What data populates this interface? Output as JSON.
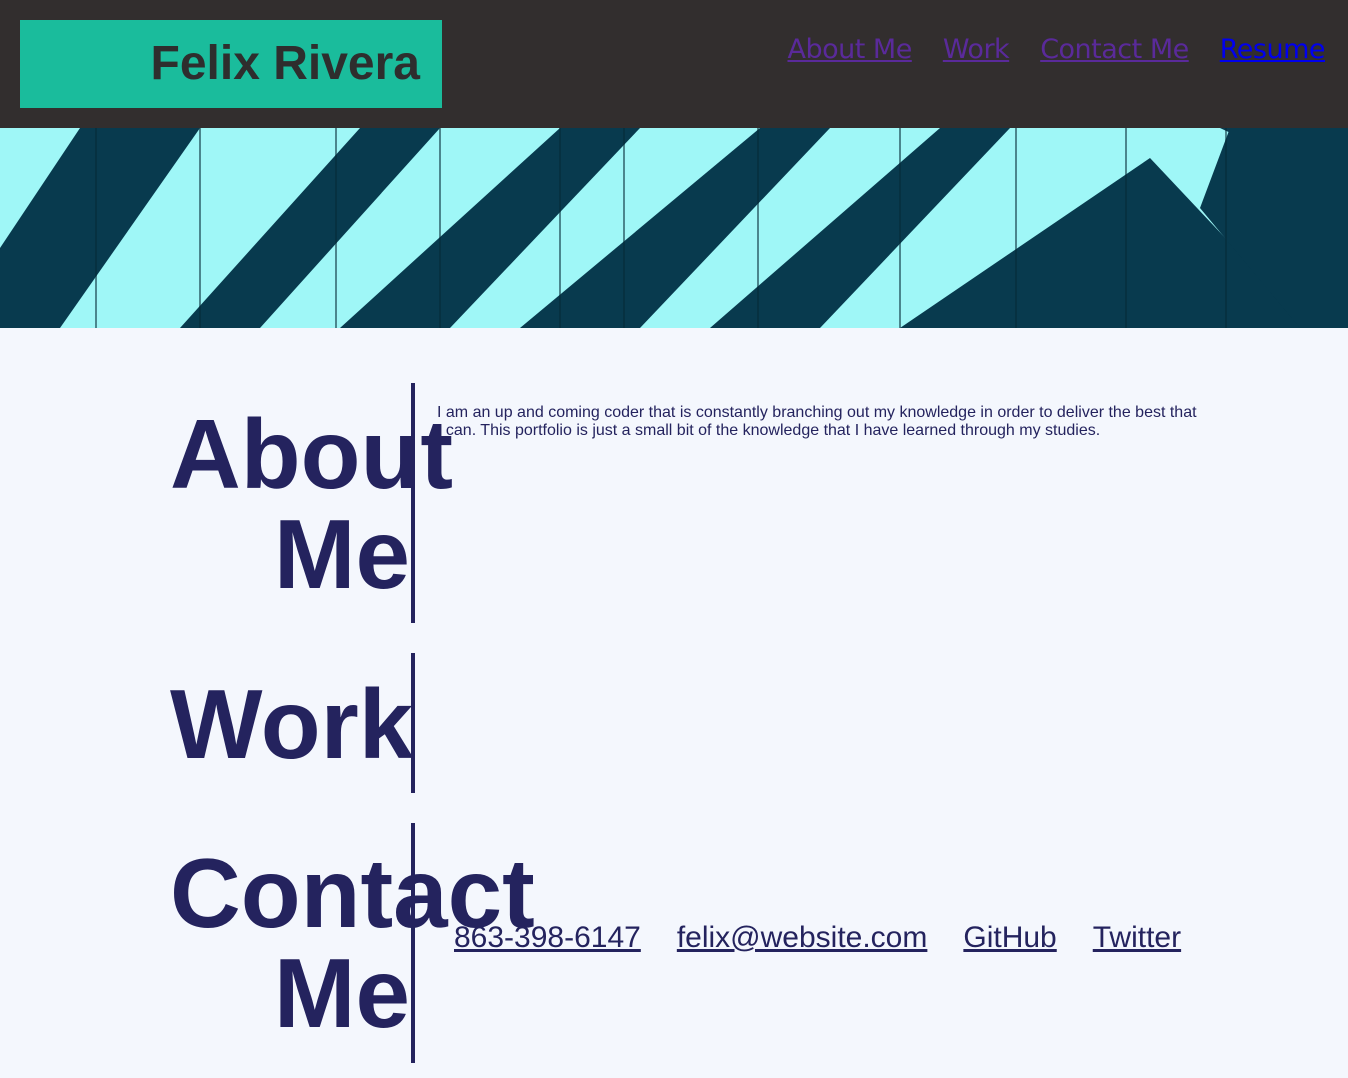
{
  "header": {
    "name": "Felix Rivera",
    "nav": [
      {
        "label": "About Me"
      },
      {
        "label": "Work"
      },
      {
        "label": "Contact Me"
      },
      {
        "label": "Resume"
      }
    ]
  },
  "sections": {
    "about": {
      "title": "About Me",
      "body": "I am an up and coming coder that is constantly branching out my knowledge in order to deliver the best that I can. This portfolio is just a small bit of the knowledge that I have learned through my studies."
    },
    "work": {
      "title": "Work"
    },
    "contact": {
      "title": "Contact Me",
      "links": [
        {
          "label": "863-398-6147"
        },
        {
          "label": "felix@website.com"
        },
        {
          "label": "GitHub"
        },
        {
          "label": "Twitter"
        }
      ]
    }
  },
  "colors": {
    "header_bg": "#322e2e",
    "logo_bg": "#1abc9c",
    "text_navy": "#24235e",
    "page_bg": "#f4f7fd",
    "banner_light": "#9ff7f7",
    "banner_dark": "#083a4e"
  }
}
